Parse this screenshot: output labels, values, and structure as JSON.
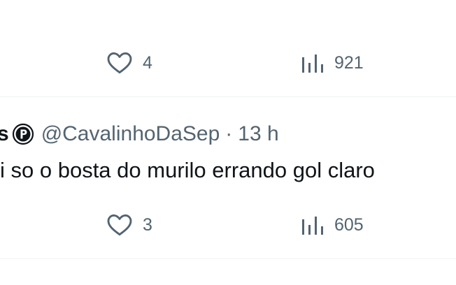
{
  "tweets": [
    {
      "actions": {
        "like_count": "4",
        "views_count": "921"
      }
    },
    {
      "header": {
        "name_fragment": "s",
        "handle": "@CavalinhoDaSep",
        "separator": "·",
        "time": "13 h"
      },
      "text": "i so o bosta do murilo errando gol claro",
      "actions": {
        "like_count": "3",
        "views_count": "605"
      }
    }
  ],
  "icons": {
    "like": "heart-icon",
    "views": "views-bar-chart-icon",
    "badge": "circled-p-badge-icon"
  },
  "colors": {
    "text_primary": "#0f1419",
    "text_secondary": "#536471",
    "divider": "#eff3f4"
  }
}
